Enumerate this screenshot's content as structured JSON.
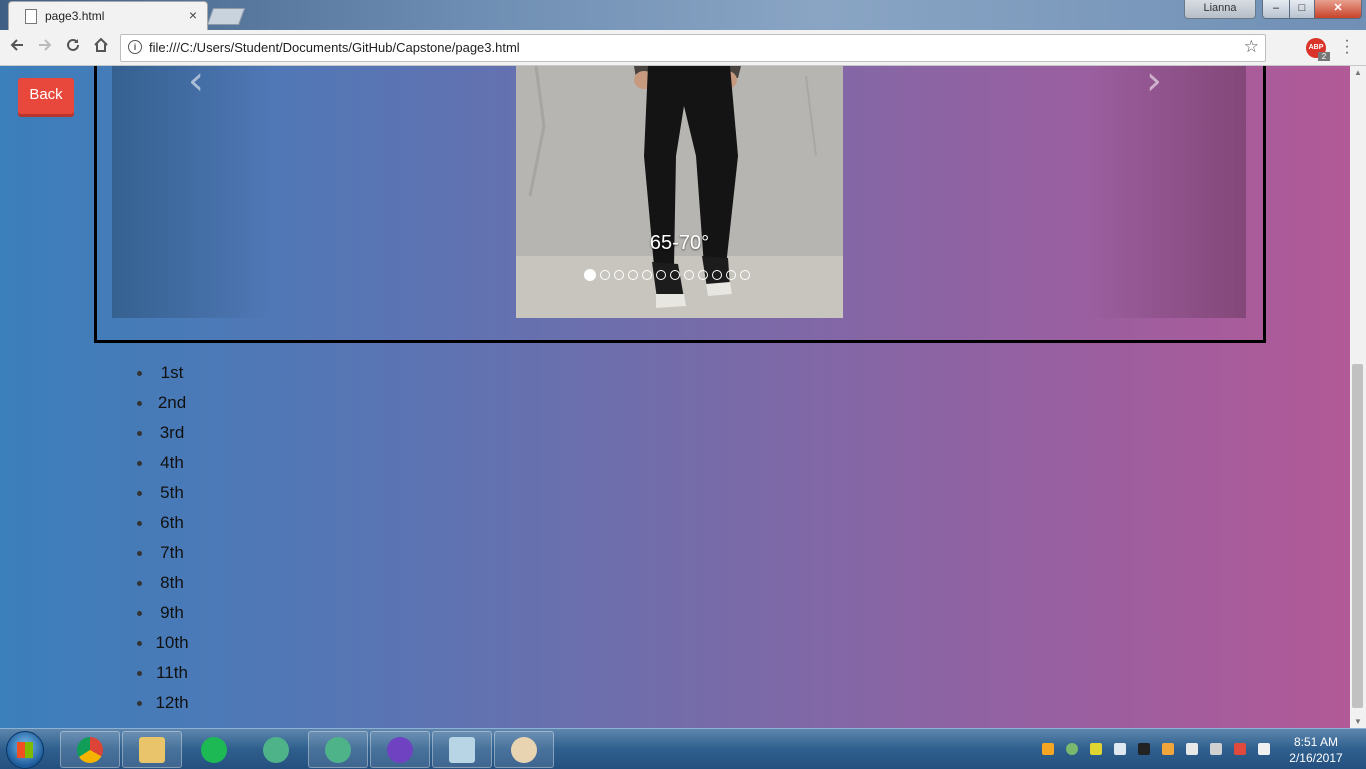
{
  "browser": {
    "tab_title": "page3.html",
    "tab_close": "×",
    "user_name": "Lianna",
    "url": "file:///C:/Users/Student/Documents/GitHub/Capstone/page3.html",
    "abp_label": "ABP",
    "abp_count": "2",
    "window_controls": {
      "minimize": "–",
      "maximize": "□",
      "close": "✕"
    }
  },
  "page": {
    "back_label": "Back",
    "carousel": {
      "prev": "‹",
      "next": "›",
      "caption": "65-70°",
      "indicator_count": 12,
      "active_index": 0
    },
    "grades": [
      "1st",
      "2nd",
      "3rd",
      "4th",
      "5th",
      "6th",
      "7th",
      "8th",
      "9th",
      "10th",
      "11th",
      "12th"
    ]
  },
  "taskbar": {
    "apps": [
      "chrome-icon",
      "file-explorer-icon",
      "spotify-icon",
      "atom-icon",
      "atom-icon",
      "github-desktop-icon",
      "notepad-icon",
      "paint-icon"
    ],
    "time": "8:51 AM",
    "date": "2/16/2017"
  },
  "colors": {
    "back_button": "#e8473b",
    "gradient_left": "#3b7fbb",
    "gradient_right": "#b25997"
  }
}
